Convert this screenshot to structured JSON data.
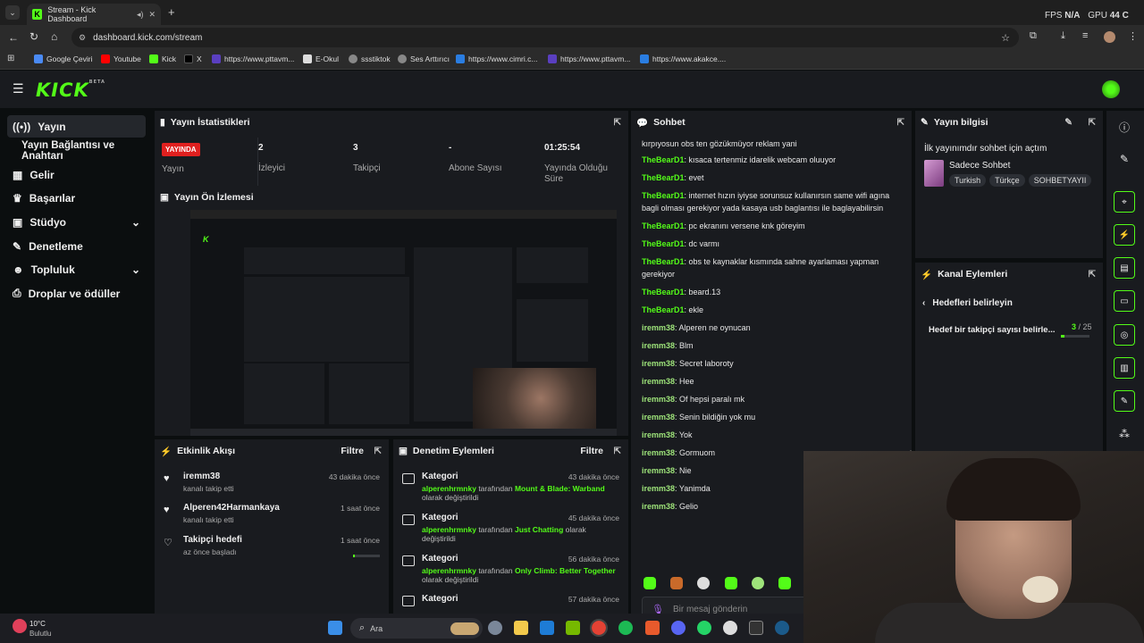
{
  "browser": {
    "tab_title": "Stream - Kick Dashboard",
    "url": "dashboard.kick.com/stream",
    "overlay": {
      "fps_label": "FPS",
      "fps_value": "N/A",
      "gpu_label": "GPU",
      "gpu_value": "44 C"
    },
    "bookmarks": [
      "Google Çeviri",
      "Youtube",
      "Kick",
      "X",
      "https://www.pttavm...",
      "E-Okul",
      "ssstiktok",
      "Ses Arttırıcı",
      "https://www.cimri.c...",
      "https://www.pttavm...",
      "https://www.akakce...."
    ]
  },
  "app": {
    "logo": "KICK",
    "logo_sup": "BETA",
    "sidebar": [
      {
        "label": "Yayın",
        "icon": "broadcast-icon",
        "active": true
      },
      {
        "label": "Yayın Bağlantısı ve Anahtarı",
        "sub": true
      },
      {
        "label": "Gelir",
        "icon": "revenue-icon"
      },
      {
        "label": "Başarılar",
        "icon": "trophy-icon"
      },
      {
        "label": "Stüdyo",
        "icon": "studio-icon",
        "expand": true
      },
      {
        "label": "Denetleme",
        "icon": "wrench-icon"
      },
      {
        "label": "Topluluk",
        "icon": "community-icon",
        "expand": true
      },
      {
        "label": "Droplar ve ödüller",
        "icon": "gift-icon"
      }
    ],
    "stats": {
      "title": "Yayın İstatistikleri",
      "live_badge": "YAYINDA",
      "items": [
        {
          "value": "",
          "label": "Yayın"
        },
        {
          "value": "2",
          "label": "İzleyici"
        },
        {
          "value": "3",
          "label": "Takipçi"
        },
        {
          "value": "-",
          "label": "Abone Sayısı"
        },
        {
          "value": "01:25:54",
          "label": "Yayında Olduğu Süre"
        }
      ]
    },
    "preview": {
      "title": "Yayın Ön İzlemesi"
    },
    "activity": {
      "title": "Etkinlik Akışı",
      "filter": "Filtre",
      "items": [
        {
          "name": "iremm38",
          "sub": "kanalı takip etti",
          "time": "43 dakika önce"
        },
        {
          "name": "Alperen42Harmankaya",
          "sub": "kanalı takip etti",
          "time": "1 saat önce"
        },
        {
          "name": "Takipçi hedefi",
          "sub": "az önce başladı",
          "time": "1 saat önce"
        }
      ]
    },
    "moderation": {
      "title": "Denetim Eylemleri",
      "filter": "Filtre",
      "items": [
        {
          "title": "Kategori",
          "user": "alperenhrmnky",
          "mid": " tarafından ",
          "game": "Mount & Blade: Warband",
          "tail": " olarak değiştirildi",
          "time": "43 dakika önce"
        },
        {
          "title": "Kategori",
          "user": "alperenhrmnky",
          "mid": " tarafından ",
          "game": "Just Chatting",
          "tail": " olarak değiştirildi",
          "time": "45 dakika önce"
        },
        {
          "title": "Kategori",
          "user": "alperenhrmnky",
          "mid": " tarafından ",
          "game": "Only Climb: Better Together",
          "tail": " olarak değiştirildi",
          "time": "56 dakika önce"
        },
        {
          "title": "Kategori",
          "user": "",
          "mid": "",
          "game": "",
          "tail": "",
          "time": "57 dakika önce"
        }
      ]
    },
    "chat": {
      "title": "Sohbet",
      "top_partial": "kırpıyosun obs ten gözükmüyor reklam yani",
      "messages": [
        {
          "user": "TheBearD1",
          "text": "kısaca tertenmiz idarelik webcam oluuyor"
        },
        {
          "user": "TheBearD1",
          "text": "evet"
        },
        {
          "user": "TheBearD1",
          "text": "internet hızın iyiyse sorunsuz kullanırsın same wifi agına bagli olması gerekiyor yada kasaya usb baglantısı ile baglayabilirsin"
        },
        {
          "user": "TheBearD1",
          "text": "pc ekranını versene knk göreyim"
        },
        {
          "user": "TheBearD1",
          "text": "dc varmı"
        },
        {
          "user": "TheBearD1",
          "text": "obs te kaynaklar kısmında sahne ayarlaması yapman gerekiyor"
        },
        {
          "user": "TheBearD1",
          "text": "beard.13"
        },
        {
          "user": "TheBearD1",
          "text": "ekle"
        },
        {
          "user": "iremm38",
          "text": "Alperen ne oynucan"
        },
        {
          "user": "iremm38",
          "text": "Blm"
        },
        {
          "user": "iremm38",
          "text": "Secret laboroty"
        },
        {
          "user": "iremm38",
          "text": "Hee"
        },
        {
          "user": "iremm38",
          "text": "Of hepsi paralı mk"
        },
        {
          "user": "iremm38",
          "text": "Senin bildiğin yok mu"
        },
        {
          "user": "iremm38",
          "text": "Yok"
        },
        {
          "user": "iremm38",
          "text": "Gormuom"
        },
        {
          "user": "iremm38",
          "text": "Nie"
        },
        {
          "user": "iremm38",
          "text": "Yanimda"
        },
        {
          "user": "iremm38",
          "text": "Gelio"
        }
      ],
      "input_placeholder": "Bir mesaj gönderin"
    },
    "stream_info": {
      "title": "Yayın bilgisi",
      "stream_title": "İlk yayınımdır sohbet için açtım",
      "category": "Sadece Sohbet",
      "tags": [
        "Turkish",
        "Türkçe",
        "SOHBETYAYII"
      ]
    },
    "channel_actions": {
      "title": "Kanal Eylemleri",
      "back_label": "Hedefleri belirleyin",
      "goal_label": "Hedef bir takipçi sayısı belirle...",
      "goal_current": "3",
      "goal_total": "/ 25",
      "goal_fraction": 0.12
    }
  },
  "taskbar": {
    "weather_temp": "10°C",
    "weather_desc": "Bulutlu",
    "search": "Ara"
  }
}
